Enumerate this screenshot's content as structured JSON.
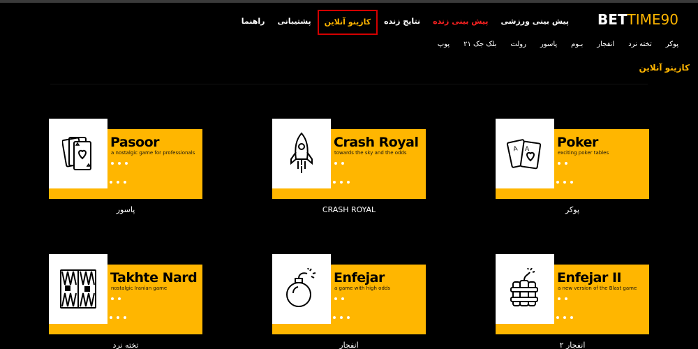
{
  "logo": {
    "part1": "BET",
    "part2": "TIME90"
  },
  "mainnav": [
    {
      "label": "پیش بینی ورزشی",
      "style": "white"
    },
    {
      "label": "پیش بینی زنده",
      "style": "red"
    },
    {
      "label": "نتایج زنده",
      "style": "white"
    },
    {
      "label": "کازینو آنلاین",
      "style": "active"
    },
    {
      "label": "پشتیبانی",
      "style": "white"
    },
    {
      "label": "راهنما",
      "style": "white"
    }
  ],
  "subnav": [
    "پوکر",
    "تخته نرد",
    "انفجار",
    "بـوم",
    "پاسور",
    "رولت",
    "بلک جک ۲۱",
    "پوپ"
  ],
  "section_title": "کازینو آنلاین",
  "cards": [
    {
      "id": "pasoor",
      "title": "Pasoor",
      "desc": "a nostalgic game for professionals",
      "label": "پاسور",
      "icon": "cards-heart-icon"
    },
    {
      "id": "crash",
      "title": "Crash Royal",
      "desc": "towards the sky and the odds",
      "label": "CRASH ROYAL",
      "icon": "rocket-icon"
    },
    {
      "id": "poker",
      "title": "Poker",
      "desc": "exciting poker tables",
      "label": "پوکر",
      "icon": "poker-cards-icon"
    },
    {
      "id": "nard",
      "title": "Takhte Nard",
      "desc": "nostalgic  Iranian game",
      "label": "تخته نرد",
      "icon": "backgammon-board-icon"
    },
    {
      "id": "enfejar",
      "title": "Enfejar",
      "desc": "a game with high odds",
      "label": "انفجار",
      "icon": "bomb-icon"
    },
    {
      "id": "enfejar2",
      "title": "Enfejar II",
      "desc": "a new version of the Blast game",
      "label": "انفجار ۲",
      "icon": "dynamite-icon"
    }
  ],
  "colors": {
    "accent": "#ffb600",
    "live": "#ff2222",
    "highlight_border": "#d40000"
  }
}
